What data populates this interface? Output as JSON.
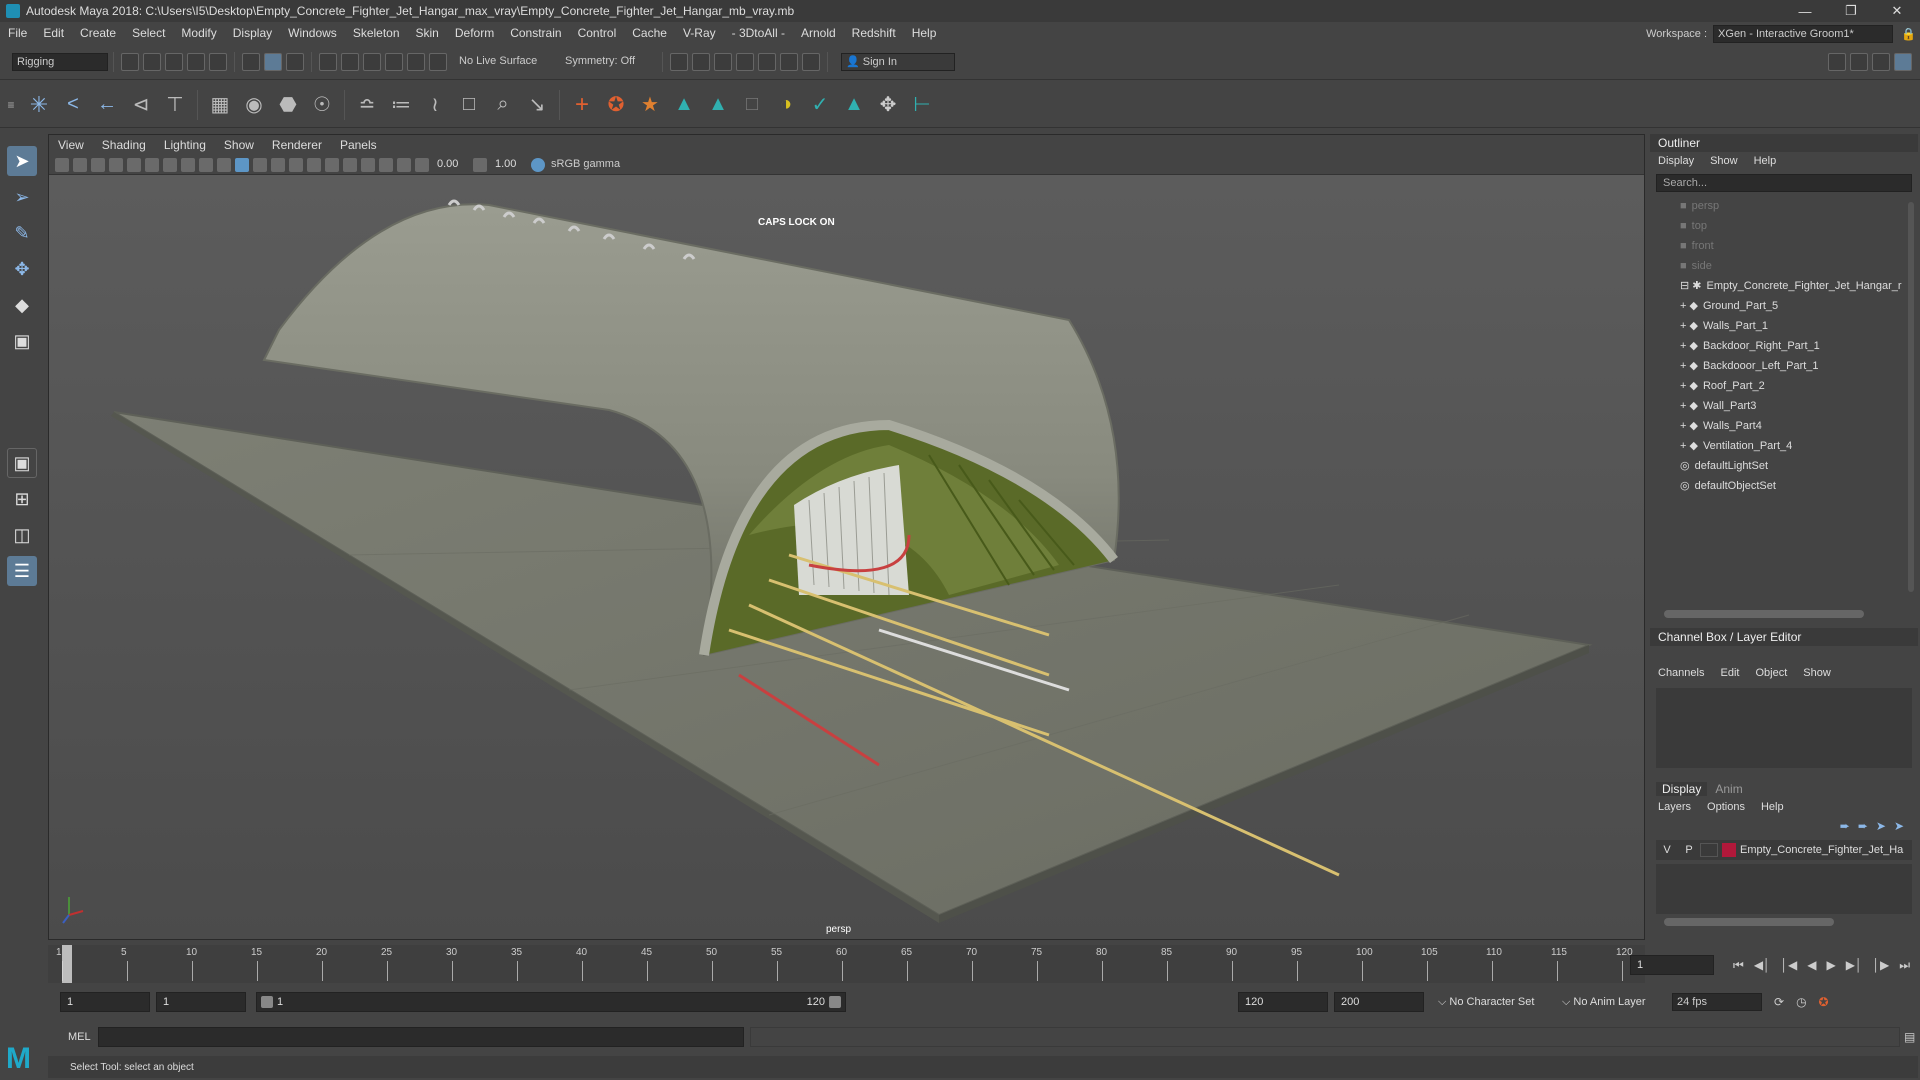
{
  "window": {
    "title": "Autodesk Maya 2018: C:\\Users\\I5\\Desktop\\Empty_Concrete_Fighter_Jet_Hangar_max_vray\\Empty_Concrete_Fighter_Jet_Hangar_mb_vray.mb"
  },
  "menubar": [
    "File",
    "Edit",
    "Create",
    "Select",
    "Modify",
    "Display",
    "Windows",
    "Skeleton",
    "Skin",
    "Deform",
    "Constrain",
    "Control",
    "Cache",
    "V-Ray",
    "- 3DtoAll -",
    "Arnold",
    "Redshift",
    "Help"
  ],
  "workspace": {
    "label": "Workspace :",
    "value": "XGen - Interactive Groom1*"
  },
  "statusline": {
    "mode": "Rigging",
    "live_surface": "No Live Surface",
    "symmetry": "Symmetry: Off",
    "sign_in": "Sign In"
  },
  "viewport": {
    "menu": [
      "View",
      "Shading",
      "Lighting",
      "Show",
      "Renderer",
      "Panels"
    ],
    "exposure": "0.00",
    "gamma": "1.00",
    "colorspace": "sRGB gamma",
    "caps_lock": "CAPS LOCK ON",
    "camera_label": "persp"
  },
  "outliner": {
    "title": "Outliner",
    "menu": [
      "Display",
      "Show",
      "Help"
    ],
    "search_placeholder": "Search...",
    "cameras": [
      "persp",
      "top",
      "front",
      "side"
    ],
    "group": "Empty_Concrete_Fighter_Jet_Hangar_r",
    "children": [
      "Ground_Part_5",
      "Walls_Part_1",
      "Backdoor_Right_Part_1",
      "Backdooor_Left_Part_1",
      "Roof_Part_2",
      "Wall_Part3",
      "Walls_Part4",
      "Ventilation_Part_4"
    ],
    "sets": [
      "defaultLightSet",
      "defaultObjectSet"
    ]
  },
  "channelbox": {
    "title": "Channel Box / Layer Editor",
    "menu": [
      "Channels",
      "Edit",
      "Object",
      "Show"
    ]
  },
  "layers": {
    "tabs": [
      "Display",
      "Anim"
    ],
    "menu": [
      "Layers",
      "Options",
      "Help"
    ],
    "row": {
      "v": "V",
      "p": "P",
      "name": "Empty_Concrete_Fighter_Jet_Ha",
      "color": "#b0183a"
    }
  },
  "timeline": {
    "ticks": [
      "1",
      "5",
      "10",
      "15",
      "20",
      "25",
      "30",
      "35",
      "40",
      "45",
      "50",
      "55",
      "60",
      "65",
      "70",
      "75",
      "80",
      "85",
      "90",
      "95",
      "100",
      "105",
      "110",
      "115",
      "120"
    ],
    "current_frame": "1"
  },
  "range": {
    "start": "1",
    "anim_start": "1",
    "slider_start": "1",
    "slider_end": "120",
    "end": "120",
    "anim_end": "200",
    "character_set": "No Character Set",
    "anim_layer": "No Anim Layer",
    "fps": "24 fps"
  },
  "cmdline": {
    "lang": "MEL"
  },
  "helpline": {
    "text": "Select Tool: select an object"
  }
}
